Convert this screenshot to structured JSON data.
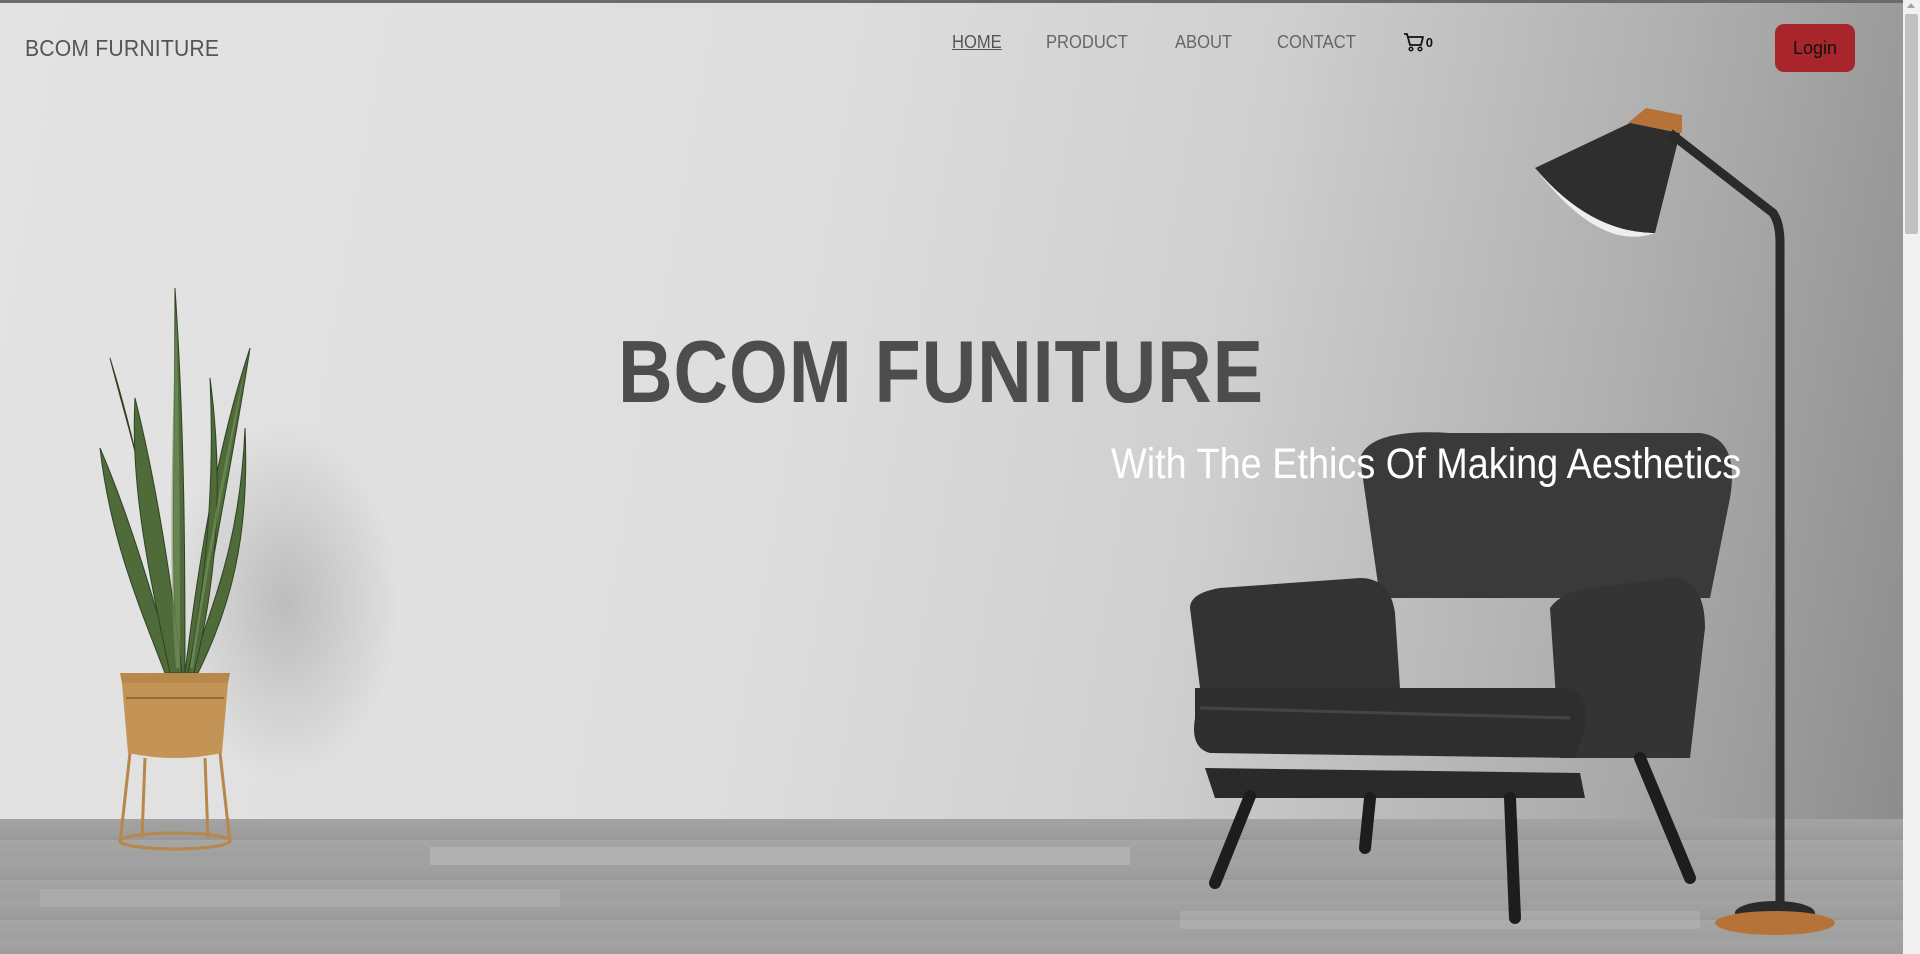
{
  "brand": "BCOM FURNITURE",
  "nav": {
    "links": [
      "HOME",
      "PRODUCT",
      "ABOUT",
      "CONTACT"
    ],
    "active": "HOME",
    "cart_count": "0",
    "login_label": "Login"
  },
  "hero": {
    "title": "BCOM FUNITURE",
    "subtitle": "With The Ethics Of Making Aesthetics"
  },
  "colors": {
    "login_button": "#a8262b",
    "title_text": "#4d4d4d",
    "subtitle_text": "#ffffff"
  },
  "icons": [
    "cart-icon"
  ]
}
